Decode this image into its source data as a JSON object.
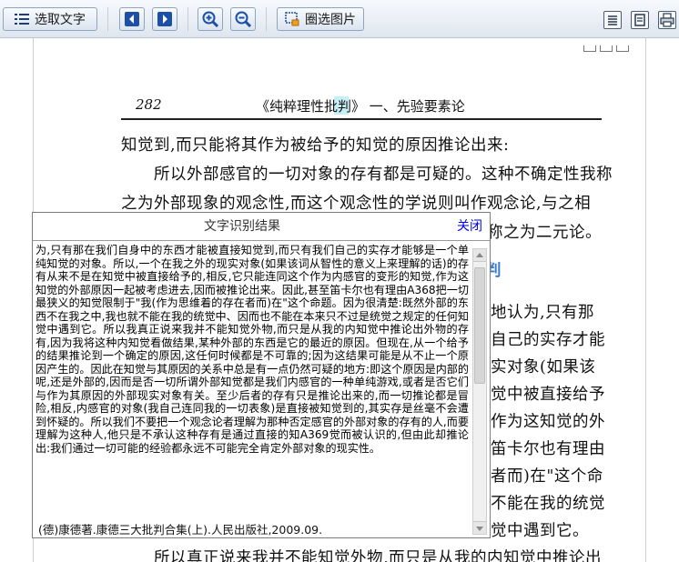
{
  "toolbar": {
    "select_text_label": "选取文字",
    "select_image_label": "圈选图片"
  },
  "document": {
    "page_number": "282",
    "running_title": "《纯粹理性批判》 一、先验要素论",
    "lines": [
      "知觉到,而只能将其作为被给予的知觉的原因推论出来:",
      "所以外部感官的一切对象的存有都是可疑的。这种不确定性我称",
      "之为外部现象的观念性,而这个观念性的学说则叫作观念论,与之相",
      "比,对外部感官对象的一种可能的确定性的主张则被称之为二元论。"
    ],
    "right_fragments": [
      "地认为,只有那",
      "自己的实存才能",
      "实对象(如果该",
      "觉中被直接给予",
      "作为这知觉的外",
      "笛卡尔也有理由",
      "者而)在\"这个命",
      "不能在我的统觉",
      "觉中遇到它。"
    ],
    "bottom_line": "所以真正说来我并不能知觉外物,而只是从我的内知觉中推论出",
    "heading_fragment": "判"
  },
  "popup": {
    "title": "文字识别结果",
    "close_label": "关闭",
    "text": "为,只有那在我们自身中的东西才能被直接知觉到,而只有我们自己的实存才能够是一个单纯知觉的对象。所以,一个在我之外的现实对象(如果该词从智性的意义上来理解的话)的存有从来不是在知觉中被直接给予的,相反,它只能连同这个作为内感官的变形的知觉,作为这知觉的外部原因一起被考虑进去,因而被推论出来。因此,甚至笛卡尔也有理由A368把一切最狭义的知觉限制于\"我(作为思维着的存在者而)在\"这个命题。因为很清楚:既然外部的东西不在我之中,我也就不能在我的统觉中、因而也不能在本来只不过是统觉之规定的任何知觉中遇到它。所以我真正说来我并不能知觉外物,而只是从我的内知觉中推论出外物的存有,因为我将这种内知觉看做结果,某种外部的东西是它的最近的原因。但现在,从一个给予的结果推论到一个确定的原因,这任何时候都是不可靠的;因为这结果可能是从不止一个原因产生的。因此在知觉与其原因的关系中总是有一点仍然可疑的地方:即这个原因是内部的呢,还是外部的,因而是否一切所谓外部知觉都是我们内感官的一种单纯游戏,或者是否它们与作为其原因的外部现实对象有关。至少后者的存有只是推论出来的,而一切推论都是冒险,相反,内感官的对象(我自己连同我的一切表象)是直接被知觉到的,其实存是丝毫不会遭到怀疑的。所以我们不要把一个观念论者理解为那种否定感官的外部对象的存有的人,而要理解为这种人,他只是不承认这种存有是通过直接的知A369觉而被认识的,但由此却推论出:我们通过一切可能的经验都永远不可能完全肯定外部对象的现实性。",
    "footer": "(德)康德著.康德三大批判合集(上).人民出版社,2009.09."
  },
  "colors": {
    "link": "#0000ee",
    "highlight": "#b7ecf6"
  }
}
